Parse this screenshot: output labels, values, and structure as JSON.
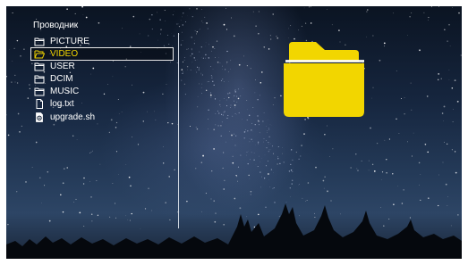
{
  "window": {
    "title": "Проводник"
  },
  "files": [
    {
      "name": "PICTURE",
      "icon": "folder-icon",
      "selected": false
    },
    {
      "name": "VIDEO",
      "icon": "folder-open-icon",
      "selected": true
    },
    {
      "name": "USER",
      "icon": "folder-icon",
      "selected": false
    },
    {
      "name": "DCIM",
      "icon": "folder-icon",
      "selected": false
    },
    {
      "name": "MUSIC",
      "icon": "folder-icon",
      "selected": false
    },
    {
      "name": "log.txt",
      "icon": "document-icon",
      "selected": false
    },
    {
      "name": "upgrade.sh",
      "icon": "script-icon",
      "selected": false
    }
  ],
  "preview": {
    "icon": "folder-icon",
    "color": "#f2d600"
  },
  "colors": {
    "selected_text": "#f2d400",
    "text": "#ffffff",
    "background": "#15233a"
  }
}
